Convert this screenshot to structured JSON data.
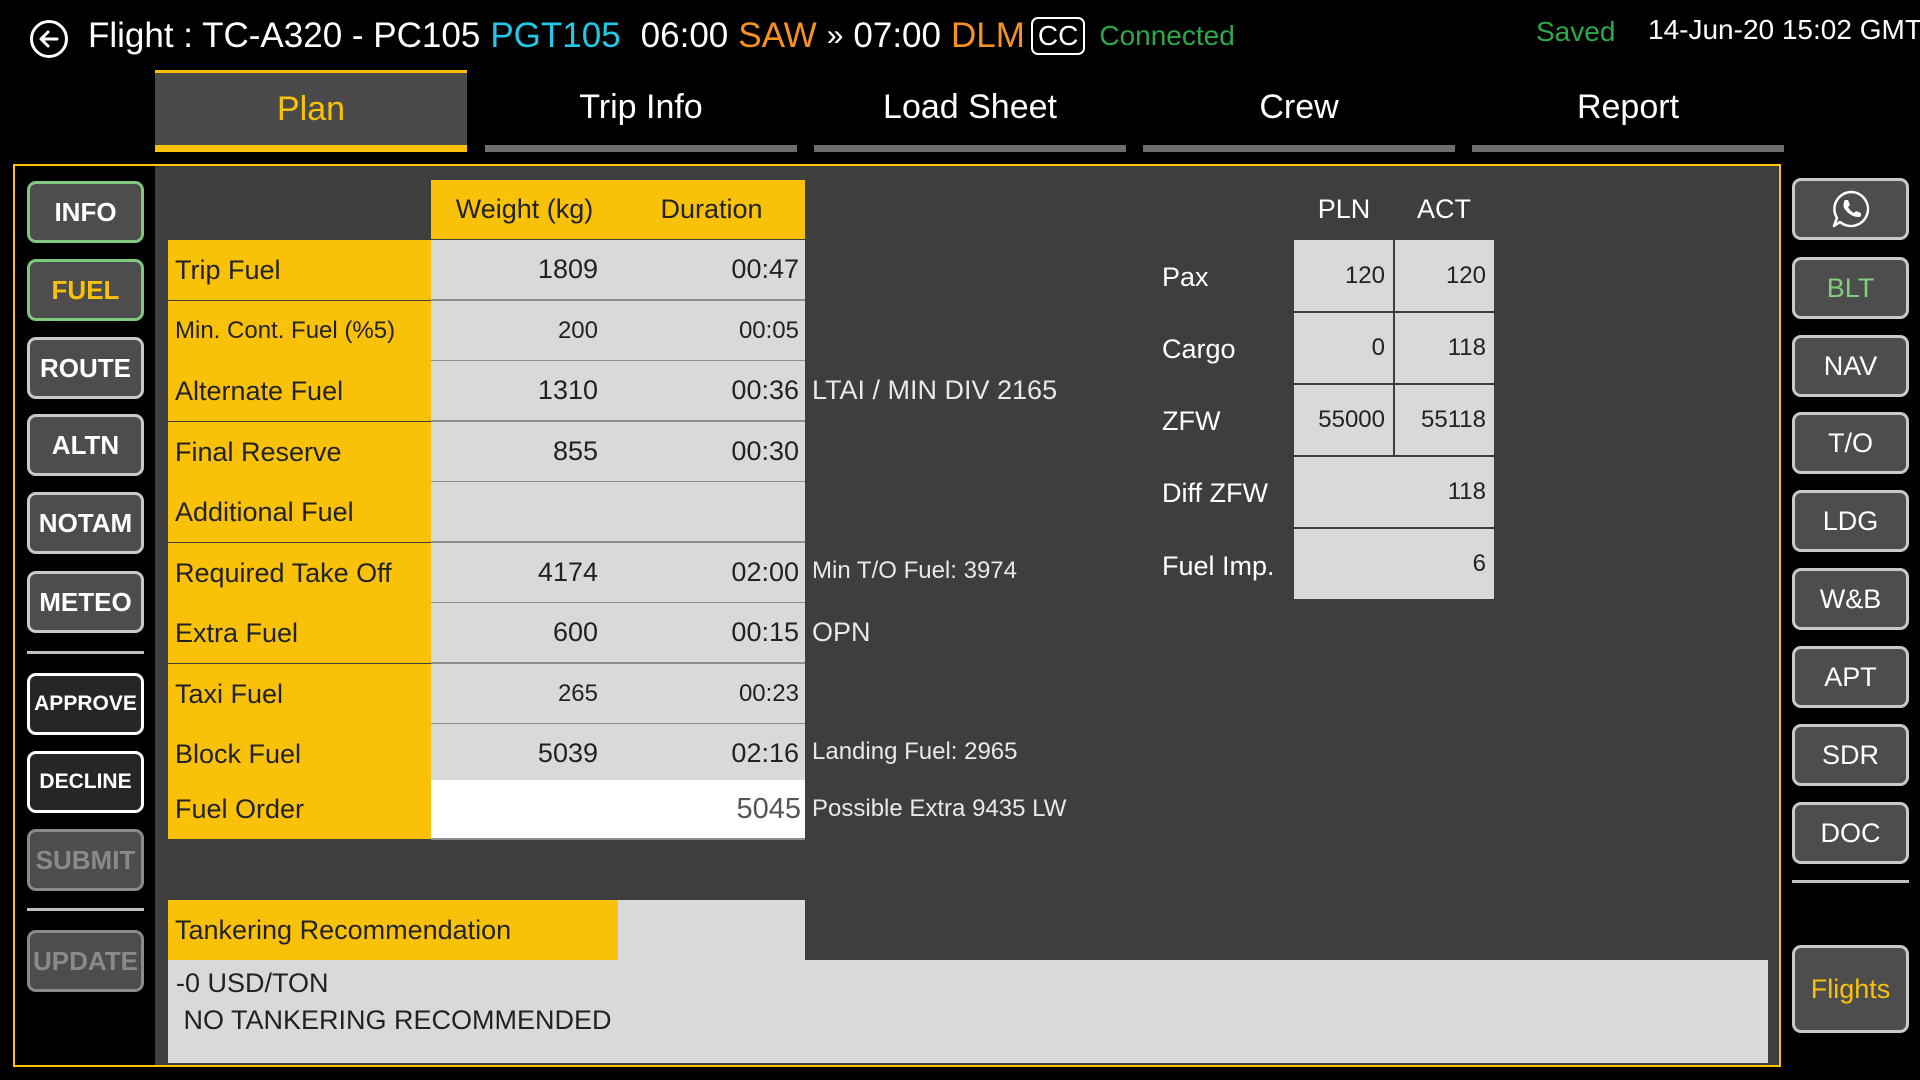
{
  "header": {
    "flight_label": "Flight : TC-A320 - PC105",
    "flight_code": "PGT105",
    "dep_time": "06:00",
    "dep_airport": "SAW",
    "arrow": "»",
    "arr_time": "07:00",
    "arr_airport": "DLM",
    "cc_badge": "CC",
    "connection_status": "Connected",
    "save_status": "Saved",
    "datetime": "14-Jun-20 15:02 GMT"
  },
  "tabs": [
    {
      "label": "Plan",
      "active": true
    },
    {
      "label": "Trip Info",
      "active": false
    },
    {
      "label": "Load Sheet",
      "active": false
    },
    {
      "label": "Crew",
      "active": false
    },
    {
      "label": "Report",
      "active": false
    }
  ],
  "left_nav": {
    "info": "INFO",
    "fuel": "FUEL",
    "route": "ROUTE",
    "altn": "ALTN",
    "notam": "NOTAM",
    "meteo": "METEO",
    "approve": "APPROVE",
    "decline": "DECLINE",
    "submit": "SUBMIT",
    "update": "UPDATE"
  },
  "right_nav": {
    "phone_icon": "whatsapp-icon",
    "blt": "BLT",
    "nav": "NAV",
    "to": "T/O",
    "ldg": "LDG",
    "wb": "W&B",
    "apt": "APT",
    "sdr": "SDR",
    "doc": "DOC",
    "flights": "Flights"
  },
  "fuel_table": {
    "col_weight": "Weight (kg)",
    "col_duration": "Duration",
    "rows": [
      {
        "label": "Trip Fuel",
        "weight": "1809",
        "duration": "00:47",
        "note": ""
      },
      {
        "label": "Min. Cont. Fuel (%5)",
        "weight": "200",
        "duration": "00:05",
        "note": ""
      },
      {
        "label": "Alternate Fuel",
        "weight": "1310",
        "duration": "00:36",
        "note": "LTAI / MIN DIV  2165"
      },
      {
        "label": "Final Reserve",
        "weight": "855",
        "duration": "00:30",
        "note": ""
      },
      {
        "label": "Additional Fuel",
        "weight": "",
        "duration": "",
        "note": ""
      },
      {
        "label": "Required Take Off",
        "weight": "4174",
        "duration": "02:00",
        "note": "Min T/O Fuel: 3974"
      },
      {
        "label": "Extra Fuel",
        "weight": "600",
        "duration": "00:15",
        "note": "OPN"
      },
      {
        "label": "Taxi Fuel",
        "weight": "265",
        "duration": "00:23",
        "note": ""
      },
      {
        "label": "Block Fuel",
        "weight": "5039",
        "duration": "02:16",
        "note": "Landing Fuel: 2965"
      }
    ],
    "fuel_order_label": "Fuel Order",
    "fuel_order_value": "5045",
    "fuel_order_note": "Possible Extra 9435 LW"
  },
  "weights_table": {
    "col_pln": "PLN",
    "col_act": "ACT",
    "pax_label": "Pax",
    "pax_pln": "120",
    "pax_act": "120",
    "cargo_label": "Cargo",
    "cargo_pln": "0",
    "cargo_act": "118",
    "zfw_label": "ZFW",
    "zfw_pln": "55000",
    "zfw_act": "55118",
    "diff_zfw_label": "Diff ZFW",
    "diff_zfw_value": "118",
    "fuel_imp_label": "Fuel Imp.",
    "fuel_imp_value": "6"
  },
  "tankering": {
    "label": "Tankering Recommendation",
    "value": "",
    "text": "-0 USD/TON\n NO TANKERING RECOMMENDED"
  },
  "colors": {
    "accent": "#f9c209",
    "connected": "#2ea84a",
    "flight_code": "#20c9e6",
    "airport": "#f7921e"
  }
}
